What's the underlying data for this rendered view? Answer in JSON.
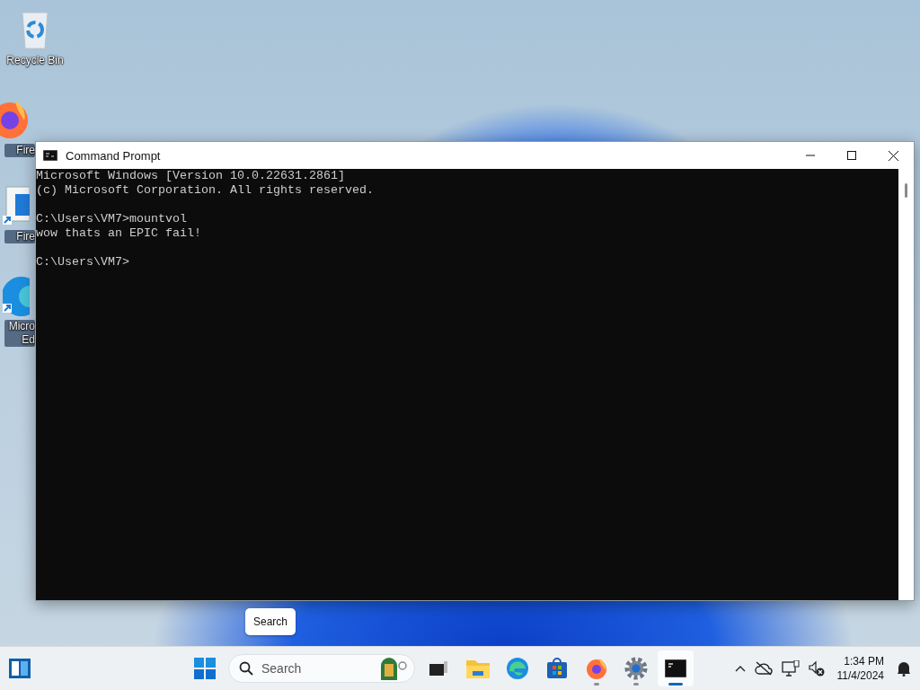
{
  "desktop_icons": [
    {
      "kind": "recycle-bin",
      "label": "Recycle Bin",
      "partly_hidden": false
    },
    {
      "kind": "firefox",
      "label": "Fire",
      "partly_hidden": true
    },
    {
      "kind": "document",
      "label": "Fire",
      "partly_hidden": true
    },
    {
      "kind": "edge",
      "label": "Micro Ed",
      "partly_hidden": true
    }
  ],
  "window": {
    "title": "Command Prompt",
    "console_blocks": [
      [
        "Microsoft Windows [Version 10.0.22631.2861]",
        "(c) Microsoft Corporation. All rights reserved."
      ],
      [
        "C:\\Users\\VM7>mountvol",
        "wow thats an EPIC fail!"
      ],
      [
        "C:\\Users\\VM7>"
      ]
    ]
  },
  "tooltip": "Search",
  "taskbar": {
    "search": {
      "placeholder": "Search"
    },
    "apps": [
      {
        "kind": "start",
        "running": false,
        "selected": false
      },
      {
        "kind": "search"
      },
      {
        "kind": "task-view",
        "running": false,
        "selected": false
      },
      {
        "kind": "folder",
        "running": false,
        "selected": false
      },
      {
        "kind": "edge",
        "running": false,
        "selected": false
      },
      {
        "kind": "store",
        "running": false,
        "selected": false
      },
      {
        "kind": "firefox",
        "running": true,
        "selected": false
      },
      {
        "kind": "settings",
        "running": true,
        "selected": false
      },
      {
        "kind": "terminal",
        "running": true,
        "selected": true
      }
    ],
    "time": "1:34 PM",
    "date": "11/4/2024"
  }
}
